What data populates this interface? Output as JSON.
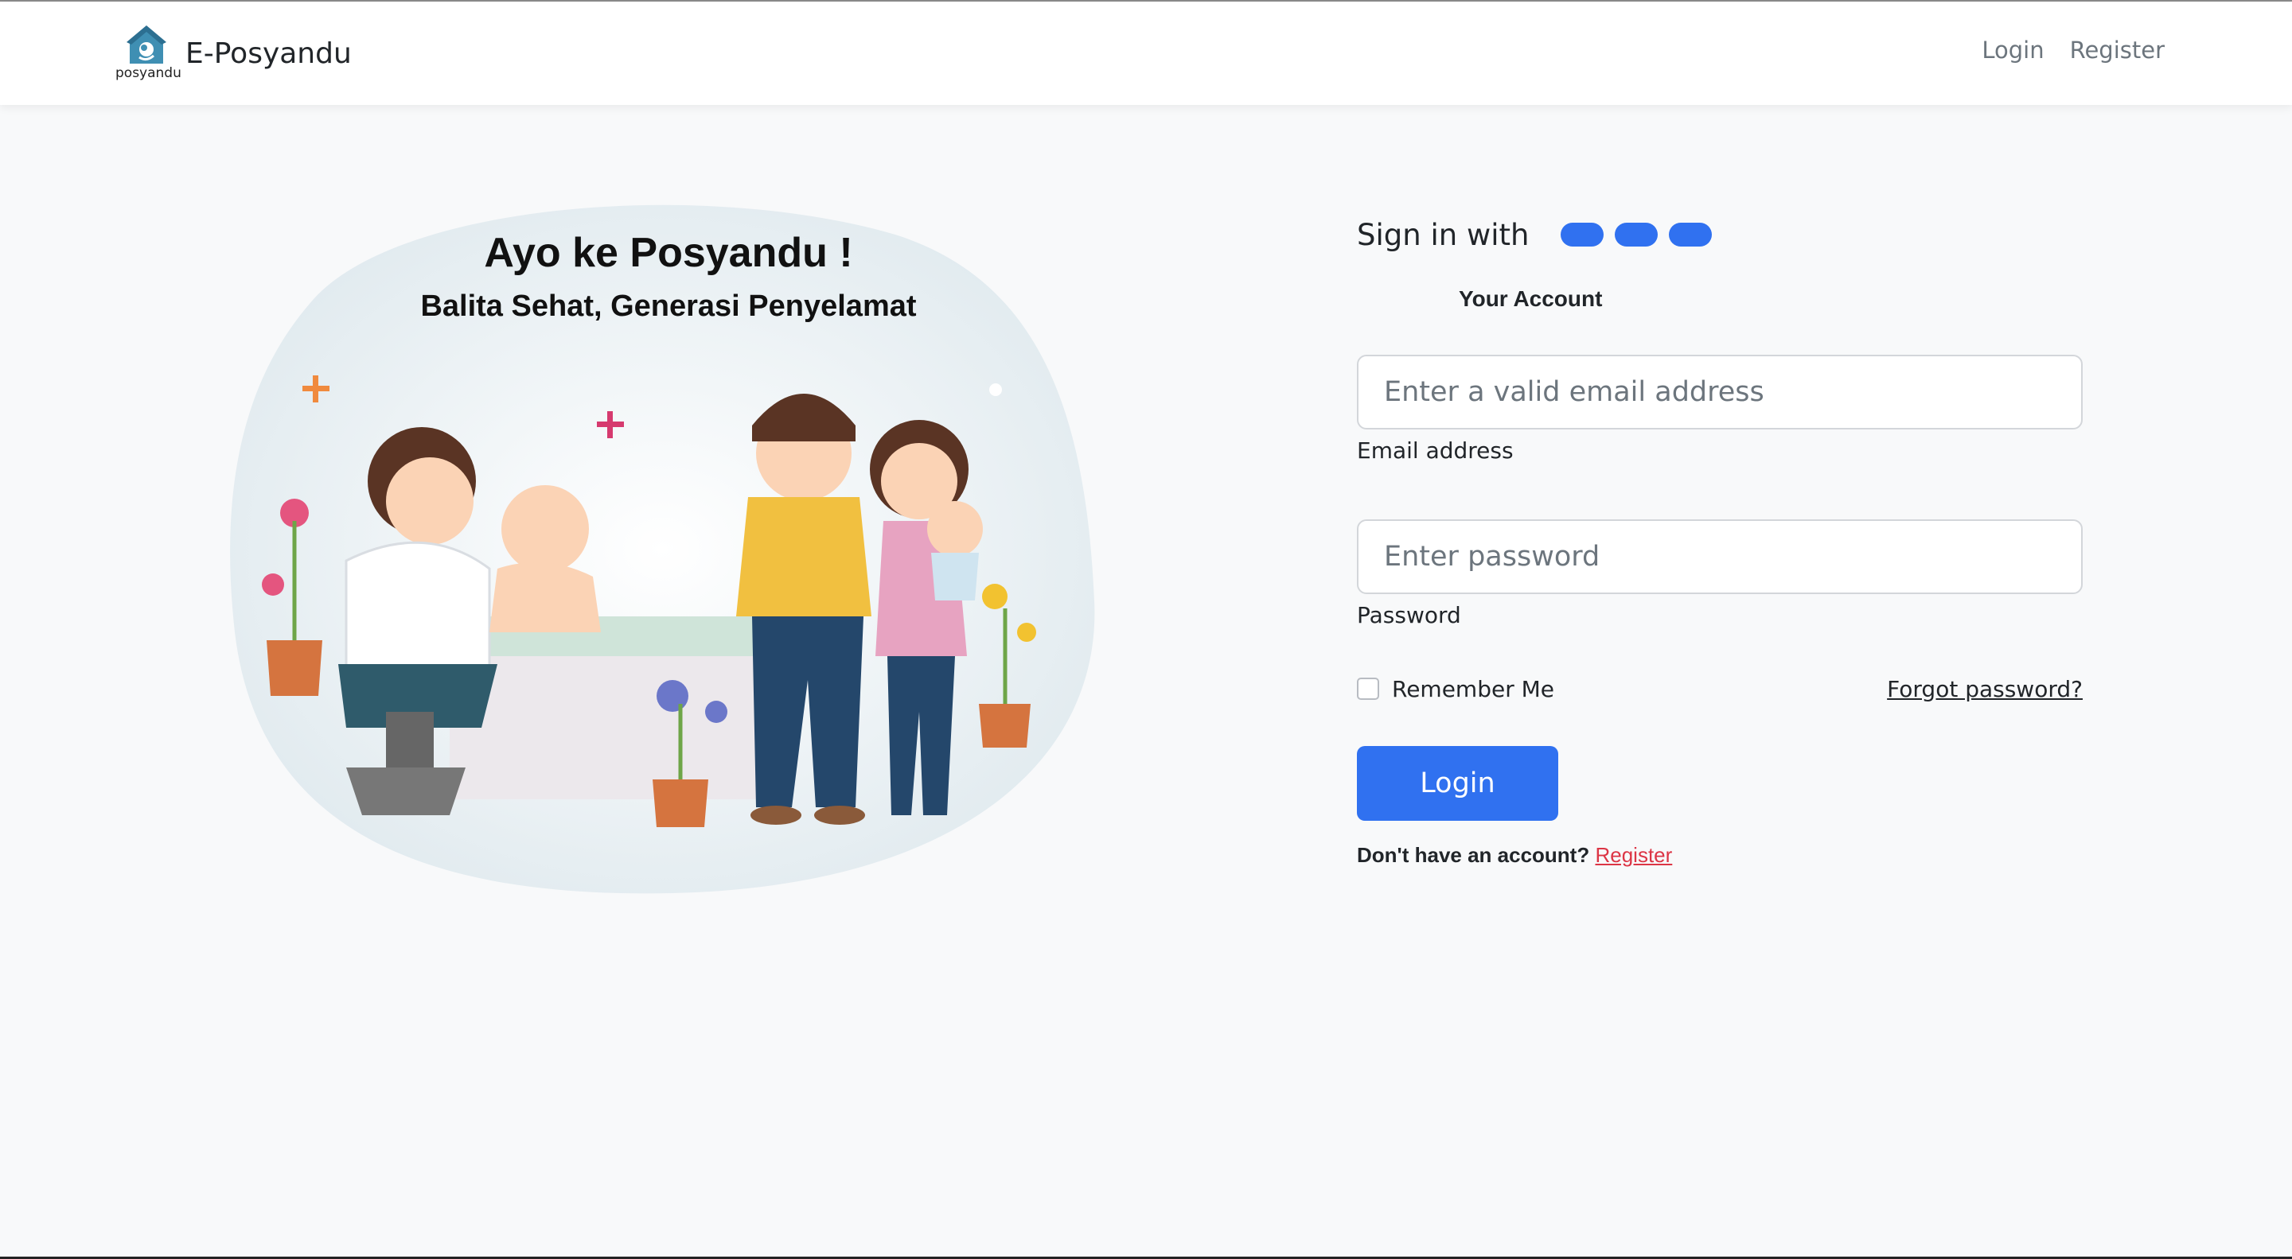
{
  "navbar": {
    "logo_text": "posyandu",
    "brand": "E-Posyandu",
    "links": [
      {
        "label": "Login"
      },
      {
        "label": "Register"
      }
    ]
  },
  "illustration": {
    "headline": "Ayo ke Posyandu !",
    "subline": "Balita Sehat, Generasi Penyelamat"
  },
  "form": {
    "signin_label": "Sign in with",
    "social_buttons": [
      "social-1",
      "social-2",
      "social-3"
    ],
    "account_heading": "Your Account",
    "email": {
      "placeholder": "Enter a valid email address",
      "label": "Email address",
      "value": ""
    },
    "password": {
      "placeholder": "Enter password",
      "label": "Password",
      "value": ""
    },
    "remember_label": "Remember Me",
    "remember_checked": false,
    "forgot_label": "Forgot password?",
    "login_button": "Login",
    "no_account_text": "Don't have an account?",
    "register_link": "Register"
  },
  "colors": {
    "primary": "#3071f0",
    "register_link": "#dc3545",
    "background": "#f8f9fa"
  }
}
